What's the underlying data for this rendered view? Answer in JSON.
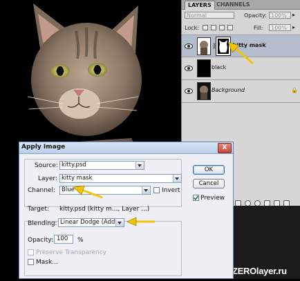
{
  "layers_panel": {
    "tabs": [
      "LAYERS",
      "CHANNELS"
    ],
    "blend_mode": "Normal",
    "opacity_label": "Opacity:",
    "opacity_value": "100%",
    "lock_label": "Lock:",
    "fill_label": "Fill:",
    "fill_value": "100%",
    "layers": [
      {
        "name": "kitty mask",
        "selected": true
      },
      {
        "name": "black",
        "selected": false
      },
      {
        "name": "Background",
        "selected": false
      }
    ]
  },
  "dialog": {
    "title": "Apply Image",
    "close_label": "X",
    "source_label": "Source:",
    "source_value": "kitty.psd",
    "layer_label": "Layer:",
    "layer_value": "kitty mask",
    "channel_label": "Channel:",
    "channel_value": "Blue",
    "invert_label": "Invert",
    "target_label": "Target:",
    "target_value": "kitty.psd (kitty m..., Layer ...)",
    "blending_label": "Blending:",
    "blending_value": "Linear Dodge (Add)",
    "opacity_label": "Opacity:",
    "opacity_value": "100",
    "opacity_unit": "%",
    "preserve_transparency_label": "Preserve Transparency",
    "mask_label": "Mask...",
    "ok_label": "OK",
    "cancel_label": "Cancel",
    "preview_label": "Preview",
    "preview_checked": true
  },
  "watermark": "ZEROlayer.ru",
  "colors": {
    "annotation_arrow": "#f2c500",
    "selected_layer": "#b3bdcc"
  }
}
